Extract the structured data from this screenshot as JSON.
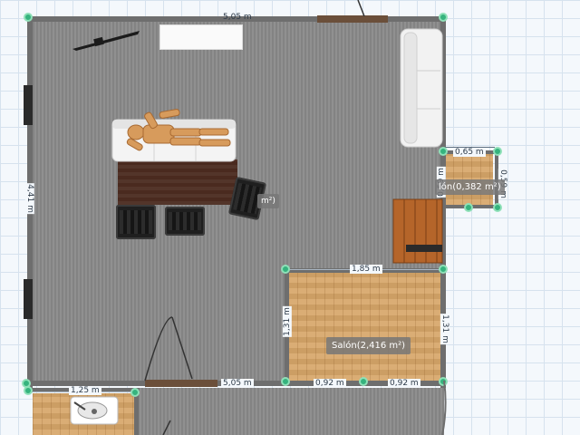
{
  "plan": {
    "top_wall_dim": "5,05 m",
    "bottom_wall_dim": "5,05 m",
    "left_wall_dim": "4,41 m",
    "small_room_width": "0,65 m",
    "small_room_height": "0,59 m",
    "small_room_left_dim": "0,59 m",
    "small_room_label": "lón(0,382 m²)",
    "partial_label": "m²)",
    "salon_width": "1,85 m",
    "salon_left_height": "1,31 m",
    "salon_right_height": "1,31 m",
    "salon_bottom_left": "0,92 m",
    "salon_bottom_right": "0,92 m",
    "salon_label": "Salón(2,416 m²)",
    "bath_width": "1,25 m"
  },
  "colors": {
    "accent_node": "#36b37e",
    "wall": "#6e6e6e",
    "floor_gray": "#8a8a8a",
    "floor_wood": "#d7a669"
  },
  "icons": [
    "sofa-icon",
    "mannequin-icon",
    "armchair-icon",
    "door-icon",
    "sink-icon",
    "stairs-icon",
    "table-icon"
  ]
}
